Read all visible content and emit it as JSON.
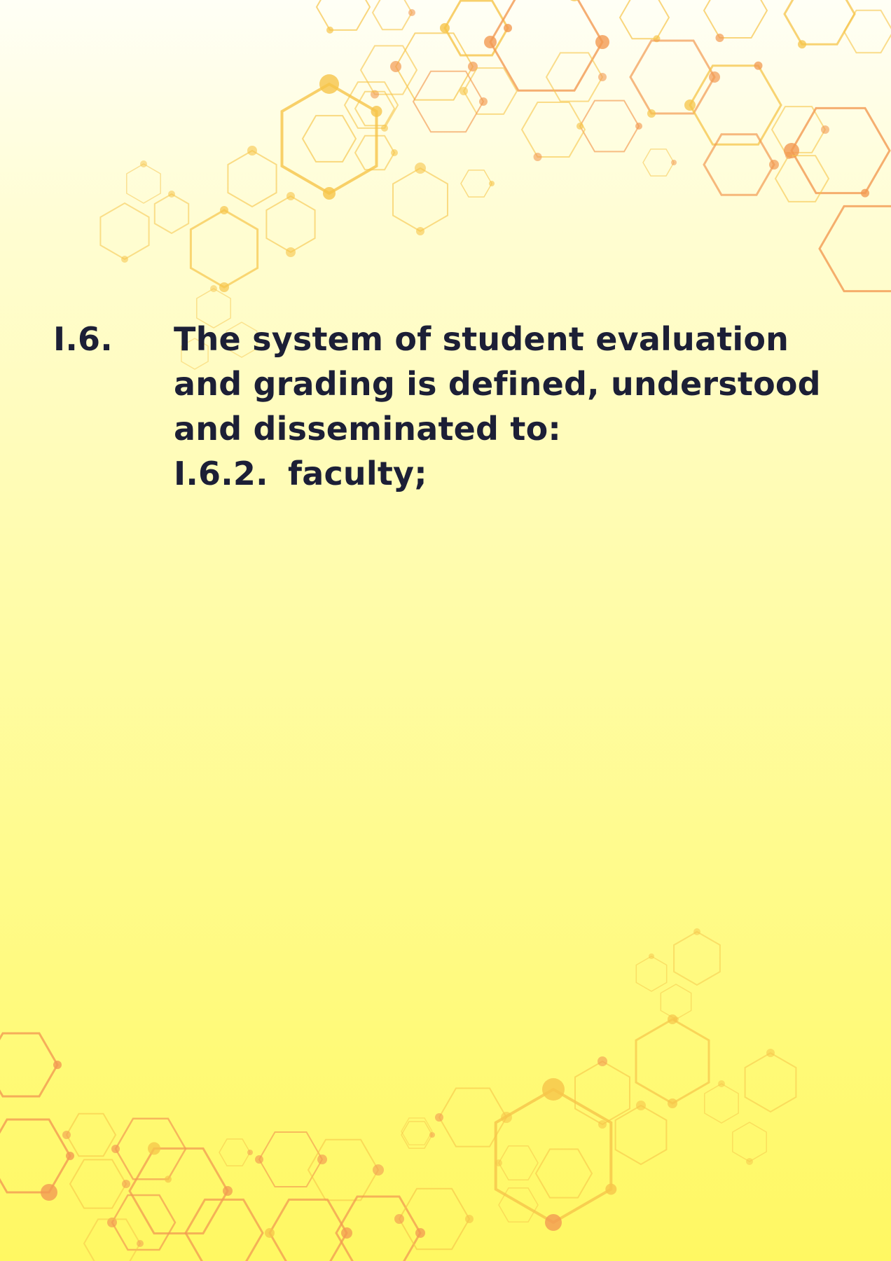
{
  "document": {
    "section_number": "I.6.",
    "section_text": "The system of student evaluation and grading is defined, understood and disseminated to:",
    "sub_item_number": "I.6.2.",
    "sub_item_text": "faculty;"
  },
  "colors": {
    "text": "#1c1f36",
    "hex_yellow": "#f6c44a",
    "hex_orange": "#f29a52",
    "background_top": "#fffff6",
    "background_bottom": "#fff862"
  },
  "decoration": {
    "motif": "hexagon-molecule-pattern"
  }
}
